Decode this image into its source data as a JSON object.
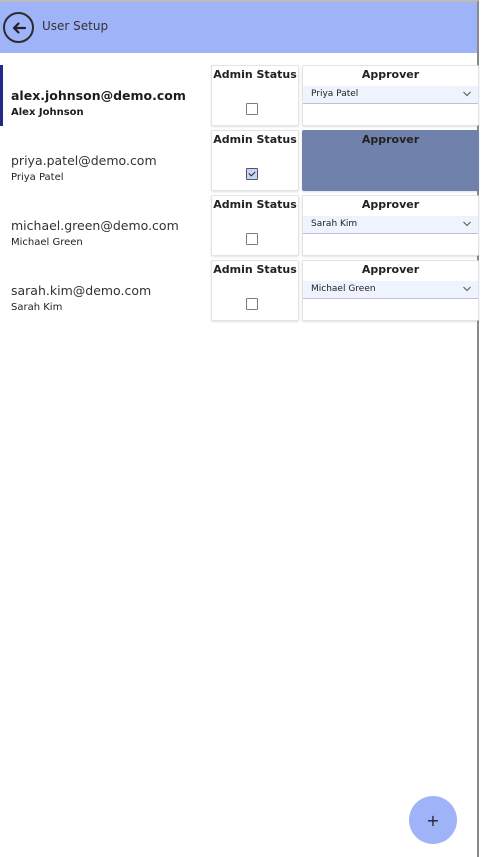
{
  "header": {
    "title": "User Setup",
    "back_icon": "arrow-left-icon"
  },
  "columns": {
    "admin_label": "Admin Status",
    "approver_label": "Approver"
  },
  "users": [
    {
      "email": "alex.johnson@demo.com",
      "name": "Alex Johnson",
      "admin": false,
      "approver": "Priya Patel",
      "selected": true
    },
    {
      "email": "priya.patel@demo.com",
      "name": "Priya Patel",
      "admin": true,
      "approver": "",
      "selected": false
    },
    {
      "email": "michael.green@demo.com",
      "name": "Michael Green",
      "admin": false,
      "approver": "Sarah Kim",
      "selected": false
    },
    {
      "email": "sarah.kim@demo.com",
      "name": "Sarah Kim",
      "admin": false,
      "approver": "Michael Green",
      "selected": false
    }
  ],
  "fab": {
    "label": "+",
    "icon": "plus-icon"
  },
  "colors": {
    "header": "#9fb3f8",
    "accent": "#1f2a8a",
    "disabled_approver": "#7082ac"
  }
}
